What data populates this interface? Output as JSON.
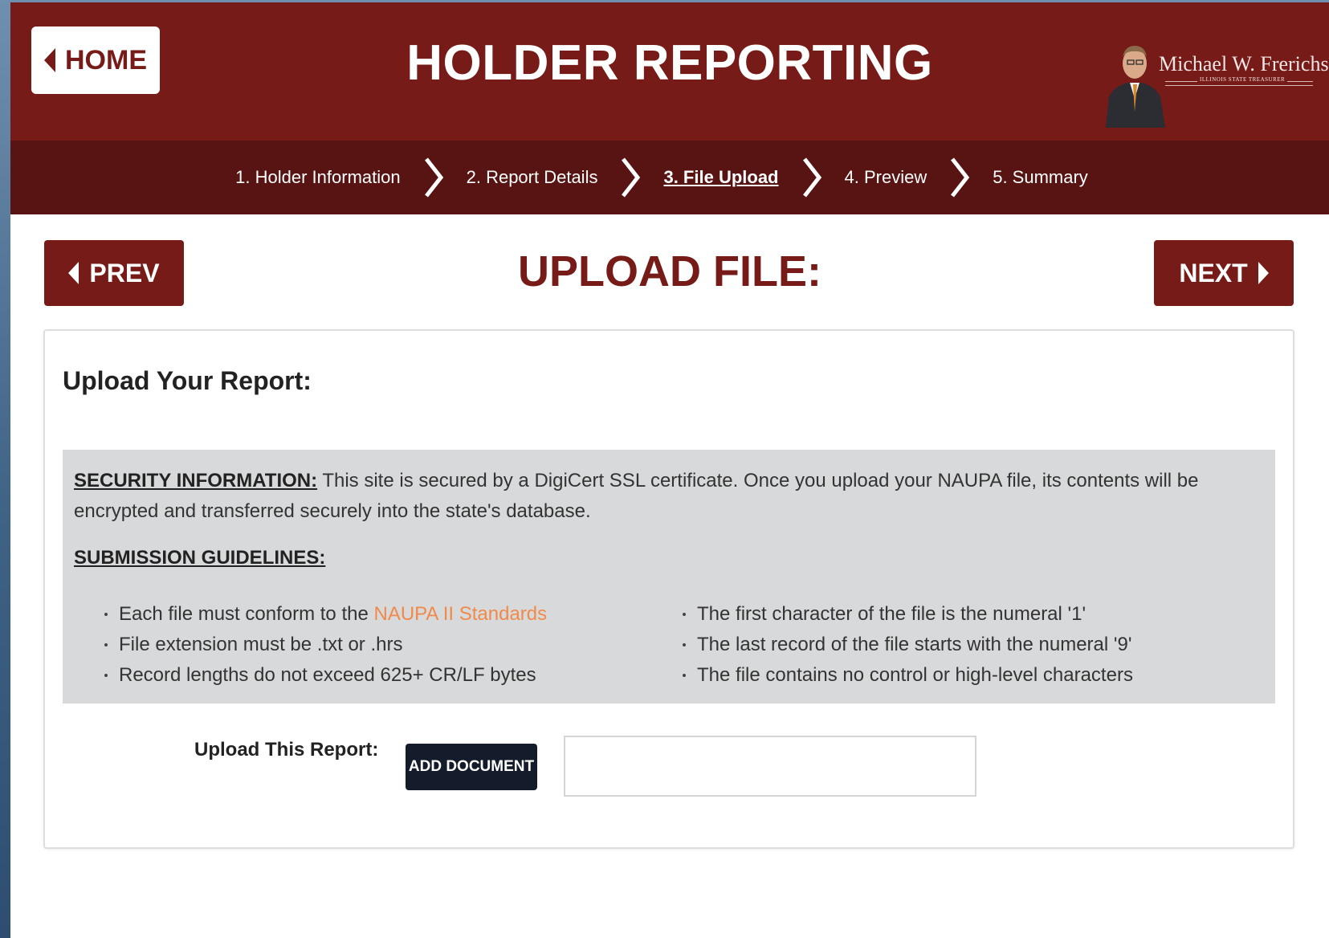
{
  "header": {
    "home_label": "HOME",
    "title": "HOLDER REPORTING",
    "treasurer_name": "Michael W. Frerichs",
    "treasurer_subtitle": "ILLINOIS STATE TREASURER"
  },
  "steps": [
    {
      "label": "1. Holder Information",
      "active": false
    },
    {
      "label": "2. Report Details",
      "active": false
    },
    {
      "label": "3. File Upload",
      "active": true
    },
    {
      "label": "4. Preview",
      "active": false
    },
    {
      "label": "5. Summary",
      "active": false
    }
  ],
  "actions": {
    "prev_label": "PREV",
    "next_label": "NEXT"
  },
  "page_heading": "UPLOAD FILE:",
  "panel": {
    "title": "Upload Your Report:",
    "security_label": "SECURITY INFORMATION:",
    "security_text": " This site is secured by a DigiCert SSL certificate. Once you upload your NAUPA file, its contents will be encrypted and transferred securely into the state's database.",
    "guidelines_label": "SUBMISSION GUIDELINES:",
    "guidelines_left": [
      {
        "prefix": "Each file must conform to the ",
        "link": "NAUPA II Standards"
      },
      {
        "text": "File extension must be .txt or .hrs"
      },
      {
        "text": "Record lengths do not exceed 625+ CR/LF bytes"
      }
    ],
    "guidelines_right": [
      "The first character of the file is the numeral '1'",
      "The last record of the file starts with the numeral '9'",
      "The file contains no control or high-level characters"
    ],
    "upload_label": "Upload This Report:",
    "add_document_label": "ADD DOCUMENT",
    "file_value": ""
  },
  "colors": {
    "brand": "#761b17",
    "nav_bar": "#571412",
    "link": "#f08a4b",
    "dark_button": "#141c2b",
    "info_bg": "#d8d9da"
  },
  "icons": {
    "home": "chevron-left-icon",
    "prev": "chevron-left-icon",
    "next": "chevron-right-icon",
    "step_separator": "chevron-right-icon"
  }
}
